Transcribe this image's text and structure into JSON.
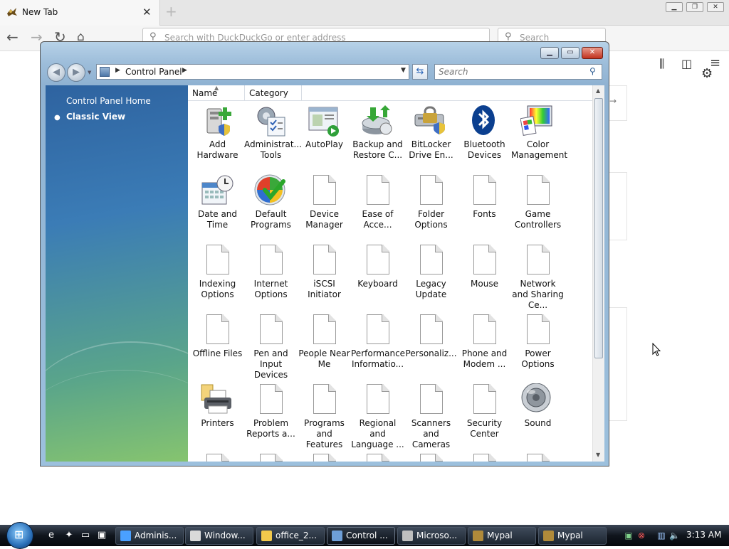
{
  "firefox": {
    "tab_title": "New Tab",
    "tab_close": "✕",
    "new_tab": "+",
    "url_placeholder": "Search with DuckDuckGo or enter address",
    "search_placeholder": "Search"
  },
  "window": {
    "title": "Control Panel",
    "breadcrumb": "Control Panel",
    "search_placeholder": "Search"
  },
  "sidebar": {
    "home": "Control Panel Home",
    "classic": "Classic View"
  },
  "columns": [
    "Name",
    "Category"
  ],
  "items": [
    {
      "label": "Add Hardware",
      "icon": "add-hardware-icon"
    },
    {
      "label": "Administrat... Tools",
      "icon": "administrative-tools-icon"
    },
    {
      "label": "AutoPlay",
      "icon": "autoplay-icon"
    },
    {
      "label": "Backup and Restore C...",
      "icon": "backup-restore-icon"
    },
    {
      "label": "BitLocker Drive En...",
      "icon": "bitlocker-icon"
    },
    {
      "label": "Bluetooth Devices",
      "icon": "bluetooth-icon"
    },
    {
      "label": "Color Management",
      "icon": "color-management-icon"
    },
    {
      "label": "Date and Time",
      "icon": "date-time-icon"
    },
    {
      "label": "Default Programs",
      "icon": "default-programs-icon"
    },
    {
      "label": "Device Manager",
      "icon": "document-icon"
    },
    {
      "label": "Ease of Acce...",
      "icon": "document-icon"
    },
    {
      "label": "Folder Options",
      "icon": "document-icon"
    },
    {
      "label": "Fonts",
      "icon": "document-icon"
    },
    {
      "label": "Game Controllers",
      "icon": "document-icon"
    },
    {
      "label": "Indexing Options",
      "icon": "document-icon"
    },
    {
      "label": "Internet Options",
      "icon": "document-icon"
    },
    {
      "label": "iSCSI Initiator",
      "icon": "document-icon"
    },
    {
      "label": "Keyboard",
      "icon": "document-icon"
    },
    {
      "label": "Legacy Update",
      "icon": "document-icon"
    },
    {
      "label": "Mouse",
      "icon": "document-icon"
    },
    {
      "label": "Network and Sharing Ce...",
      "icon": "document-icon"
    },
    {
      "label": "Offline Files",
      "icon": "document-icon"
    },
    {
      "label": "Pen and Input Devices",
      "icon": "document-icon"
    },
    {
      "label": "People Near Me",
      "icon": "document-icon"
    },
    {
      "label": "Performance Informatio...",
      "icon": "document-icon"
    },
    {
      "label": "Personaliz...",
      "icon": "document-icon"
    },
    {
      "label": "Phone and Modem ...",
      "icon": "document-icon"
    },
    {
      "label": "Power Options",
      "icon": "document-icon"
    },
    {
      "label": "Printers",
      "icon": "printers-icon"
    },
    {
      "label": "Problem Reports a...",
      "icon": "document-icon"
    },
    {
      "label": "Programs and Features",
      "icon": "document-icon"
    },
    {
      "label": "Regional and Language ...",
      "icon": "document-icon"
    },
    {
      "label": "Scanners and Cameras",
      "icon": "document-icon"
    },
    {
      "label": "Security Center",
      "icon": "document-icon"
    },
    {
      "label": "Sound",
      "icon": "sound-icon"
    }
  ],
  "taskbar": {
    "buttons": [
      {
        "label": "Adminis...",
        "icon": "ie-icon"
      },
      {
        "label": "Window...",
        "icon": "window-icon"
      },
      {
        "label": "office_2...",
        "icon": "folder-icon"
      },
      {
        "label": "Control ...",
        "icon": "control-panel-icon"
      },
      {
        "label": "Microso...",
        "icon": "installer-icon"
      },
      {
        "label": "Mypal",
        "icon": "mypal-icon"
      },
      {
        "label": "Mypal",
        "icon": "mypal-icon"
      }
    ],
    "clock": "3:13 AM"
  }
}
